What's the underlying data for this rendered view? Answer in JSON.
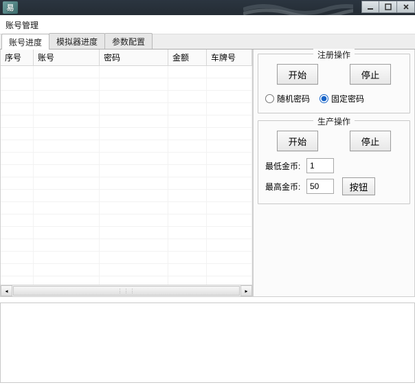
{
  "window": {
    "icon_text": "易",
    "title": "账号管理"
  },
  "tabs": [
    {
      "label": "账号进度",
      "active": true
    },
    {
      "label": "模拟器进度",
      "active": false
    },
    {
      "label": "参数配置",
      "active": false
    }
  ],
  "table": {
    "columns": [
      "序号",
      "账号",
      "密码",
      "金额",
      "车牌号"
    ],
    "rows": []
  },
  "panels": {
    "register": {
      "legend": "注册操作",
      "start": "开始",
      "stop": "停止",
      "random_pwd": "随机密码",
      "fixed_pwd": "固定密码",
      "pwd_mode": "fixed"
    },
    "produce": {
      "legend": "生产操作",
      "start": "开始",
      "stop": "停止",
      "min_gold_label": "最低金币:",
      "max_gold_label": "最高金币:",
      "min_gold": "1",
      "max_gold": "50",
      "button_label": "按钮"
    }
  },
  "bottom_text": "",
  "icons": {
    "minimize": "min-icon",
    "maximize": "max-icon",
    "close": "close-icon",
    "scroll_left": "◂",
    "scroll_right": "▸",
    "thumb_grip": "⋮⋮⋮"
  }
}
